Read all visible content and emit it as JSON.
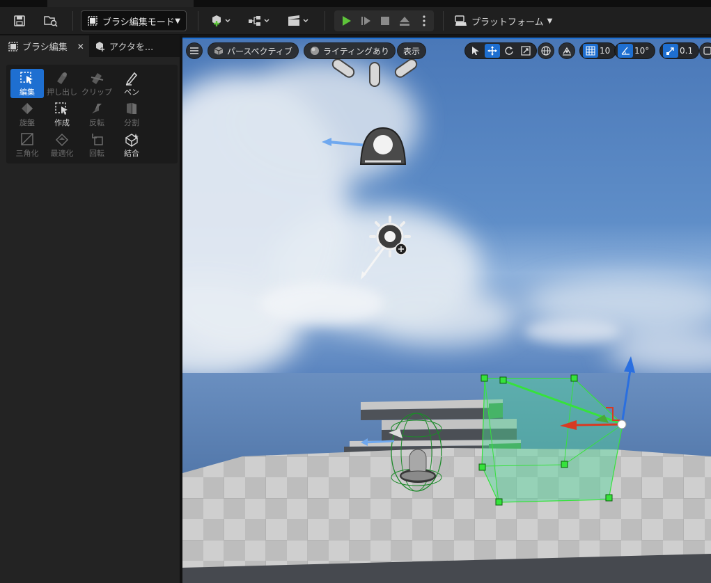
{
  "toolbar": {
    "mode_label": "ブラシ編集モード",
    "platform_label": "プラットフォーム"
  },
  "tabs": [
    {
      "label": "ブラシ編集"
    },
    {
      "label": "アクタを..."
    }
  ],
  "tools": [
    {
      "label": "編集",
      "state": "selected"
    },
    {
      "label": "押し出し",
      "state": "disabled"
    },
    {
      "label": "クリップ",
      "state": "disabled"
    },
    {
      "label": "ペン",
      "state": "enabled"
    },
    {
      "label": "旋盤",
      "state": "disabled"
    },
    {
      "label": "作成",
      "state": "enabled"
    },
    {
      "label": "反転",
      "state": "disabled"
    },
    {
      "label": "分割",
      "state": "disabled"
    },
    {
      "label": "三角化",
      "state": "disabled"
    },
    {
      "label": "最適化",
      "state": "disabled"
    },
    {
      "label": "回転",
      "state": "disabled"
    },
    {
      "label": "結合",
      "state": "enabled"
    }
  ],
  "viewport": {
    "perspective_label": "パースペクティブ",
    "lighting_label": "ライティングあり",
    "show_label": "表示",
    "grid_snap": "10",
    "rotation_snap": "10°",
    "scale_snap": "0.1"
  },
  "colors": {
    "accent": "#1e6fd1",
    "play_green": "#5ec43a",
    "selection_green": "#35e03a"
  }
}
